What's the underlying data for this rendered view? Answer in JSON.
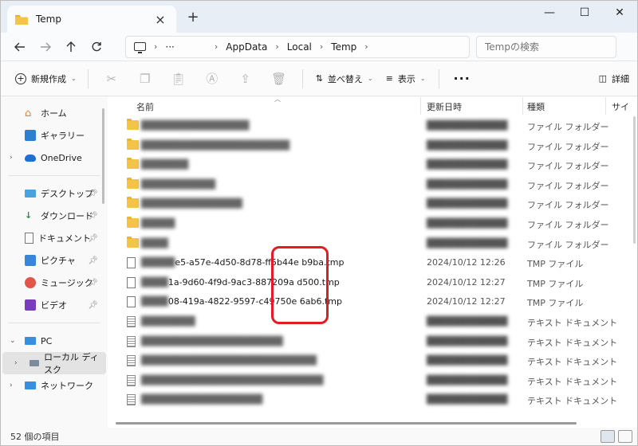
{
  "tab": {
    "title": "Temp"
  },
  "window_controls": {
    "min": "—",
    "max": "☐",
    "close": "✕"
  },
  "address": {
    "ellipsis": "···",
    "crumbs": [
      "AppData",
      "Local",
      "Temp"
    ],
    "search_placeholder": "Tempの検索"
  },
  "toolbar": {
    "new_label": "新規作成",
    "sort_label": "並べ替え",
    "view_label": "表示",
    "more_label": "···",
    "details_label": "詳細"
  },
  "sidebar": {
    "items": [
      {
        "label": "ホーム"
      },
      {
        "label": "ギャラリー"
      },
      {
        "label": "OneDrive"
      },
      {
        "label": "デスクトップ"
      },
      {
        "label": "ダウンロード"
      },
      {
        "label": "ドキュメント"
      },
      {
        "label": "ピクチャ"
      },
      {
        "label": "ミュージック"
      },
      {
        "label": "ビデオ"
      },
      {
        "label": "PC"
      },
      {
        "label": "ローカル ディスク"
      },
      {
        "label": "ネットワーク"
      }
    ]
  },
  "columns": {
    "name": "名前",
    "date": "更新日時",
    "type": "種類",
    "size": "サイ"
  },
  "files": [
    {
      "name": "",
      "date": "",
      "type": "ファイル フォルダー"
    },
    {
      "name": "",
      "date": "",
      "type": "ファイル フォルダー"
    },
    {
      "name": "",
      "date": "",
      "type": "ファイル フォルダー"
    },
    {
      "name": "",
      "date": "",
      "type": "ファイル フォルダー"
    },
    {
      "name": "",
      "date": "",
      "type": "ファイル フォルダー"
    },
    {
      "name": "",
      "date": "",
      "type": "ファイル フォルダー"
    },
    {
      "name": "",
      "date": "",
      "type": "ファイル フォルダー"
    },
    {
      "name": "e5-a57e-4d50-8d78-ff5b44e b9ba.tmp",
      "date": "2024/10/12 12:26",
      "type": "TMP ファイル"
    },
    {
      "name": "1a-9d60-4f9d-9ac3-887209a d500.tmp",
      "date": "2024/10/12 12:27",
      "type": "TMP ファイル"
    },
    {
      "name": "08-419a-4822-9597-c49750e 6ab6.tmp",
      "date": "2024/10/12 12:27",
      "type": "TMP ファイル"
    },
    {
      "name": "",
      "date": "",
      "type": "テキスト ドキュメント"
    },
    {
      "name": "",
      "date": "",
      "type": "テキスト ドキュメント"
    },
    {
      "name": "",
      "date": "",
      "type": "テキスト ドキュメント"
    },
    {
      "name": "",
      "date": "",
      "type": "テキスト ドキュメント"
    },
    {
      "name": "",
      "date": "",
      "type": "テキスト ドキュメント"
    }
  ],
  "status": {
    "count": "52 個の項目"
  }
}
